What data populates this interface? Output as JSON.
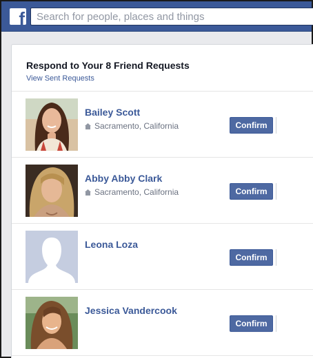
{
  "header": {
    "logo_letter": "f",
    "search_placeholder": "Search for people, places and things",
    "brand_color": "#3b5998"
  },
  "requests": {
    "title": "Respond to Your 8 Friend Requests",
    "sent_link": "View Sent Requests",
    "confirm_label": "Confirm",
    "items": [
      {
        "name": "Bailey Scott",
        "location": "Sacramento, California",
        "avatar": "photo-woman-brunette"
      },
      {
        "name": "Abby Abby Clark",
        "location": "Sacramento, California",
        "avatar": "photo-woman-blonde"
      },
      {
        "name": "Leona Loza",
        "location": "",
        "avatar": "default-female-silhouette"
      },
      {
        "name": "Jessica Vandercook",
        "location": "",
        "avatar": "photo-woman-curly"
      }
    ]
  }
}
